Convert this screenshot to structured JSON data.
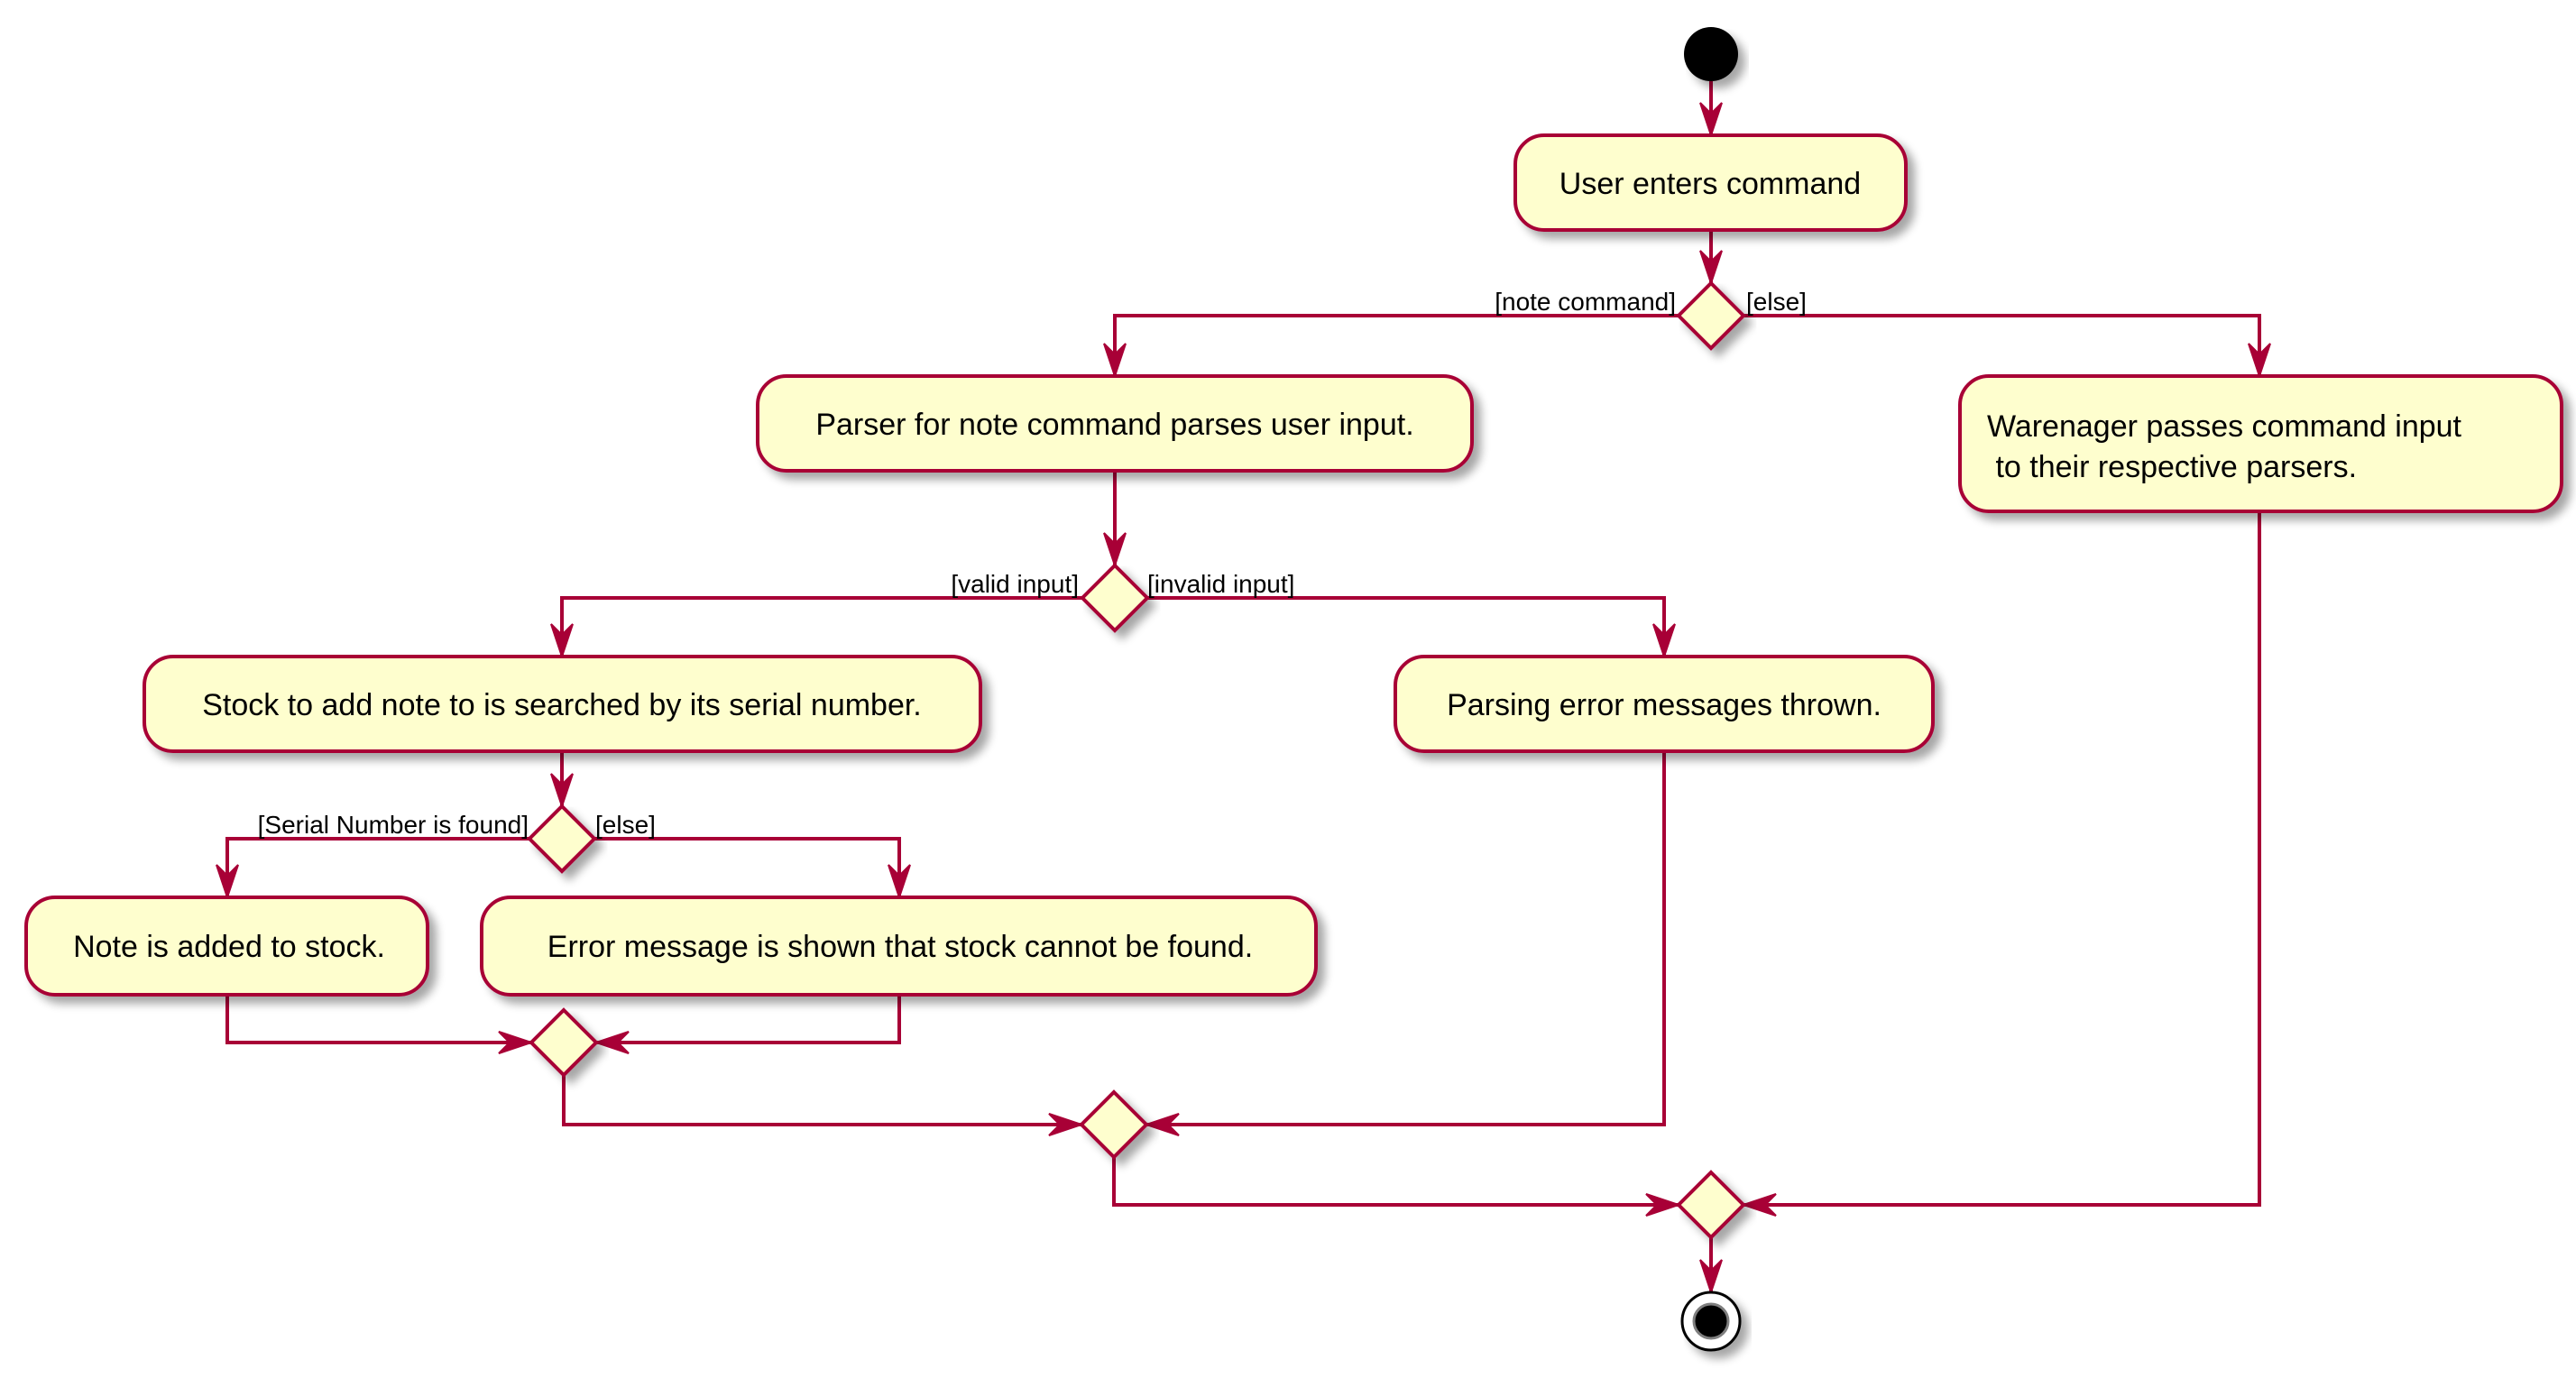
{
  "diagram": {
    "type": "activity",
    "colors": {
      "border": "#A80036",
      "fill": "#FEFECE",
      "text": "#000000",
      "start": "#000000"
    },
    "activities": [
      {
        "id": "user-enters",
        "lines": [
          "User enters command"
        ]
      },
      {
        "id": "parser-note",
        "lines": [
          "Parser for note command parses user input."
        ]
      },
      {
        "id": "warenager-passes",
        "lines": [
          "Warenager passes command input",
          " to their respective parsers."
        ]
      },
      {
        "id": "stock-search",
        "lines": [
          "Stock to add note to is searched by its serial number."
        ]
      },
      {
        "id": "parsing-error",
        "lines": [
          "Parsing error messages thrown."
        ]
      },
      {
        "id": "note-added",
        "lines": [
          "Note is added to stock."
        ]
      },
      {
        "id": "error-not-found",
        "lines": [
          "Error message is shown that stock cannot be found."
        ]
      }
    ],
    "guards": {
      "note_command": "[note command]",
      "else_1": "[else]",
      "valid_input": "[valid input]",
      "invalid_input": "[invalid input]",
      "serial_found": "[Serial Number is found]",
      "else_2": "[else]"
    }
  }
}
